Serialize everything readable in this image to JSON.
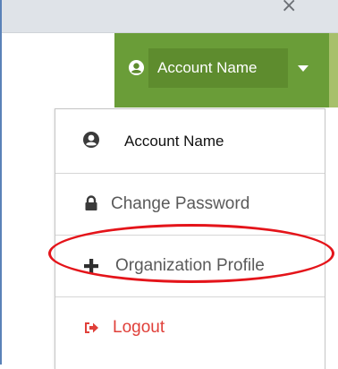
{
  "window": {
    "close_icon": "close-icon"
  },
  "navbar": {
    "account_button_label": "Account Name",
    "account_icon": "user-circle-icon",
    "dropdown_icon": "caret-down-icon",
    "accent_color": "#6a9d38"
  },
  "menu": {
    "items": [
      {
        "label": "Account Name",
        "icon": "user-circle-icon"
      },
      {
        "label": "Change Password",
        "icon": "lock-icon"
      },
      {
        "label": "Organization Profile",
        "icon": "plus-icon",
        "highlighted": true
      },
      {
        "label": "Logout",
        "icon": "sign-out-icon",
        "color": "#e0403a"
      }
    ]
  }
}
